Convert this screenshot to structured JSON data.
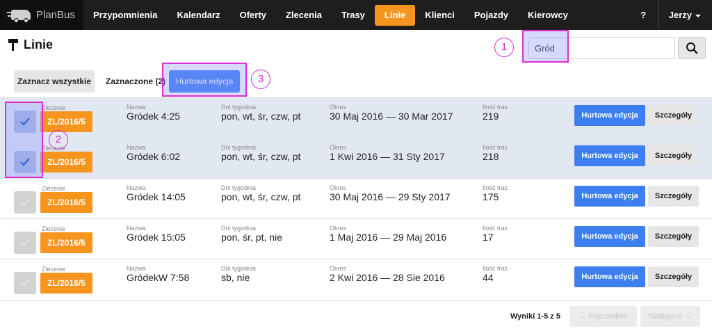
{
  "brand": {
    "name": "PlanBus",
    "logo_icon": "bus-icon"
  },
  "nav": {
    "items": [
      {
        "label": "Przypomnienia"
      },
      {
        "label": "Kalendarz"
      },
      {
        "label": "Oferty"
      },
      {
        "label": "Zlecenia"
      },
      {
        "label": "Trasy"
      },
      {
        "label": "Linie"
      },
      {
        "label": "Klienci"
      },
      {
        "label": "Pojazdy"
      },
      {
        "label": "Kierowcy"
      }
    ],
    "active": "Linie",
    "help_label": "?",
    "user_label": "Jerzy"
  },
  "page": {
    "title": "Linie",
    "title_icon": "signpost-icon"
  },
  "search": {
    "value": "Gród",
    "placeholder": "",
    "button_icon": "search-icon"
  },
  "toolbar": {
    "select_all_label": "Zaznacz wszystkie",
    "selected_label": "Zaznaczone (2)",
    "bulk_edit_label": "Hurtowa edycja"
  },
  "labels": {
    "order": "Zlecenie",
    "name": "Nazwa",
    "weekdays": "Dni tygodnia",
    "period": "Okres",
    "trip_count": "Ilość tras",
    "bulk_edit": "Hurtowa edycja",
    "details": "Szczegóły"
  },
  "rows": [
    {
      "selected": true,
      "order": "ZL/2016/5",
      "name": "Gródek 4:25",
      "weekdays": "pon, wt, śr, czw, pt",
      "period": "30 Maj 2016 — 30 Mar 2017",
      "trips": "219"
    },
    {
      "selected": true,
      "order": "ZL/2016/5",
      "name": "Gródek 6:02",
      "weekdays": "pon, wt, śr, czw, pt",
      "period": "1 Kwi 2016 — 31 Sty 2017",
      "trips": "218"
    },
    {
      "selected": false,
      "order": "ZL/2016/5",
      "name": "Gródek 14:05",
      "weekdays": "pon, wt, śr, czw, pt",
      "period": "30 Maj 2016 — 29 Sty 2017",
      "trips": "175"
    },
    {
      "selected": false,
      "order": "ZL/2016/5",
      "name": "Gródek 15:05",
      "weekdays": "pon, śr, pt, nie",
      "period": "1 Maj 2016 — 29 Maj 2016",
      "trips": "17"
    },
    {
      "selected": false,
      "order": "ZL/2016/5",
      "name": "GródekW 7:58",
      "weekdays": "sb, nie",
      "period": "2 Kwi 2016 — 28 Sie 2016",
      "trips": "44"
    }
  ],
  "footer": {
    "results_label": "Wyniki 1-5 z 5",
    "prev_label": "← Poprzednie",
    "next_label": "Następne →"
  },
  "annotations": [
    {
      "number": "1"
    },
    {
      "number": "2"
    },
    {
      "number": "3"
    }
  ],
  "colors": {
    "accent_orange": "#f5951e",
    "primary_blue": "#3d7ef0",
    "annotation_magenta": "#e02cd4",
    "selected_row": "#e2e8f2"
  }
}
